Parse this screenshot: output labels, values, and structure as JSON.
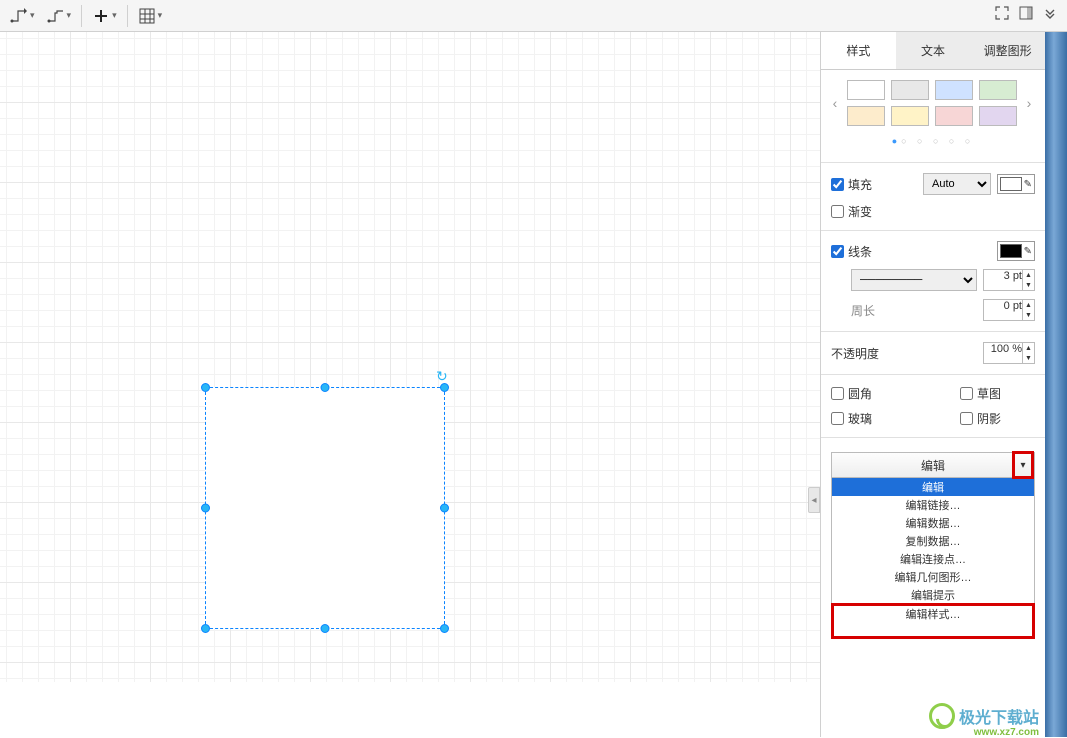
{
  "toolbar": {
    "connector1_icon": "waypoint-connector-icon",
    "connector2_icon": "straight-connector-icon",
    "add_icon": "plus-icon",
    "table_icon": "table-grid-icon"
  },
  "toolbar_right": {
    "fullscreen_icon": "fullscreen-icon",
    "format_icon": "format-panel-icon",
    "collapse_icon": "collapse-panel-icon"
  },
  "tabs": {
    "style": "样式",
    "text": "文本",
    "arrange": "调整图形"
  },
  "palette": {
    "colors": [
      "#ffffff",
      "#e8e8e8",
      "#cfe2ff",
      "#d7ecd2",
      "#fdeccc",
      "#fff3c7",
      "#f7d6d6",
      "#e2d6ef"
    ]
  },
  "fill": {
    "label": "填充",
    "checked": true,
    "mode": "Auto",
    "color": "#ffffff"
  },
  "gradient": {
    "label": "渐变",
    "checked": false
  },
  "line": {
    "label": "线条",
    "checked": true,
    "color": "#000000",
    "style": "────────",
    "width_value": "3",
    "width_unit": "pt"
  },
  "perimeter": {
    "label": "周长",
    "value": "0",
    "unit": "pt"
  },
  "opacity": {
    "label": "不透明度",
    "value": "100",
    "unit": "%"
  },
  "checks": {
    "rounded": "圆角",
    "glass": "玻璃",
    "sketch": "草图",
    "shadow": "阴影"
  },
  "edit_button": {
    "label": "编辑"
  },
  "edit_menu": {
    "items": [
      "编辑",
      "编辑链接…",
      "编辑数据…",
      "复制数据…",
      "编辑连接点…",
      "编辑几何图形…",
      "编辑提示",
      "编辑样式…"
    ]
  },
  "watermark": {
    "text": "极光下载站",
    "sub": "www.xz7.com"
  }
}
